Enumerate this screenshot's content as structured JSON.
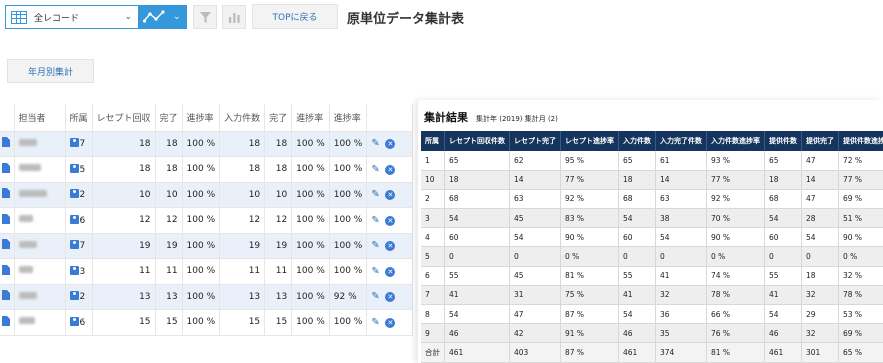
{
  "toolbar": {
    "view_label": "全レコード",
    "top_button": "TOPに戻る",
    "page_title": "原単位データ集計表",
    "year_month_button": "年月別集計"
  },
  "icons": [
    "table-grid-icon",
    "graph-icon",
    "chevron-down-icon",
    "filter-icon",
    "bar-chart-icon",
    "document-icon",
    "person-icon",
    "pencil-icon",
    "delete-icon"
  ],
  "colors": {
    "accent": "#3498db",
    "header_navy": "#15355e",
    "row_highlight": "#e9f0fa"
  },
  "record_table": {
    "headers": [
      "担当者",
      "所属",
      "レセプト回収",
      "完了",
      "進捗率",
      "入力件数",
      "完了",
      "進捗率",
      "進捗率"
    ],
    "rows": [
      {
        "dept": "7",
        "recv": "18",
        "done": "18",
        "rate": "100 %",
        "input": "18",
        "done2": "18",
        "rate2": "100 %",
        "rate3": "100 %"
      },
      {
        "dept": "5",
        "recv": "18",
        "done": "18",
        "rate": "100 %",
        "input": "18",
        "done2": "18",
        "rate2": "100 %",
        "rate3": "100 %"
      },
      {
        "dept": "2",
        "recv": "10",
        "done": "10",
        "rate": "100 %",
        "input": "10",
        "done2": "10",
        "rate2": "100 %",
        "rate3": "100 %"
      },
      {
        "dept": "6",
        "recv": "12",
        "done": "12",
        "rate": "100 %",
        "input": "12",
        "done2": "12",
        "rate2": "100 %",
        "rate3": "100 %"
      },
      {
        "dept": "7",
        "recv": "19",
        "done": "19",
        "rate": "100 %",
        "input": "19",
        "done2": "19",
        "rate2": "100 %",
        "rate3": "100 %"
      },
      {
        "dept": "3",
        "recv": "11",
        "done": "11",
        "rate": "100 %",
        "input": "11",
        "done2": "11",
        "rate2": "100 %",
        "rate3": "100 %"
      },
      {
        "dept": "2",
        "recv": "13",
        "done": "13",
        "rate": "100 %",
        "input": "13",
        "done2": "13",
        "rate2": "100 %",
        "rate3": "92 %"
      },
      {
        "dept": "6",
        "recv": "15",
        "done": "15",
        "rate": "100 %",
        "input": "15",
        "done2": "15",
        "rate2": "100 %",
        "rate3": "100 %"
      }
    ]
  },
  "summary": {
    "title": "集計結果",
    "subtitle": "集計年 (2019) 集計月 (2)",
    "headers": [
      "所属",
      "レセプト回収件数",
      "レセプト完了",
      "レセプト進捗率",
      "入力件数",
      "入力完了件数",
      "入力件数進捗率",
      "提供件数",
      "提供完了",
      "提供件数進捗率"
    ],
    "rows": [
      [
        "1",
        "65",
        "62",
        "95 %",
        "65",
        "61",
        "93 %",
        "65",
        "47",
        "72 %"
      ],
      [
        "10",
        "18",
        "14",
        "77 %",
        "18",
        "14",
        "77 %",
        "18",
        "14",
        "77 %"
      ],
      [
        "2",
        "68",
        "63",
        "92 %",
        "68",
        "63",
        "92 %",
        "68",
        "47",
        "69 %"
      ],
      [
        "3",
        "54",
        "45",
        "83 %",
        "54",
        "38",
        "70 %",
        "54",
        "28",
        "51 %"
      ],
      [
        "4",
        "60",
        "54",
        "90 %",
        "60",
        "54",
        "90 %",
        "60",
        "54",
        "90 %"
      ],
      [
        "5",
        "0",
        "0",
        "0 %",
        "0",
        "0",
        "0 %",
        "0",
        "0",
        "0 %"
      ],
      [
        "6",
        "55",
        "45",
        "81 %",
        "55",
        "41",
        "74 %",
        "55",
        "18",
        "32 %"
      ],
      [
        "7",
        "41",
        "31",
        "75 %",
        "41",
        "32",
        "78 %",
        "41",
        "32",
        "78 %"
      ],
      [
        "8",
        "54",
        "47",
        "87 %",
        "54",
        "36",
        "66 %",
        "54",
        "29",
        "53 %"
      ],
      [
        "9",
        "46",
        "42",
        "91 %",
        "46",
        "35",
        "76 %",
        "46",
        "32",
        "69 %"
      ],
      [
        "合計",
        "461",
        "403",
        "87 %",
        "461",
        "374",
        "81 %",
        "461",
        "301",
        "65 %"
      ]
    ]
  }
}
